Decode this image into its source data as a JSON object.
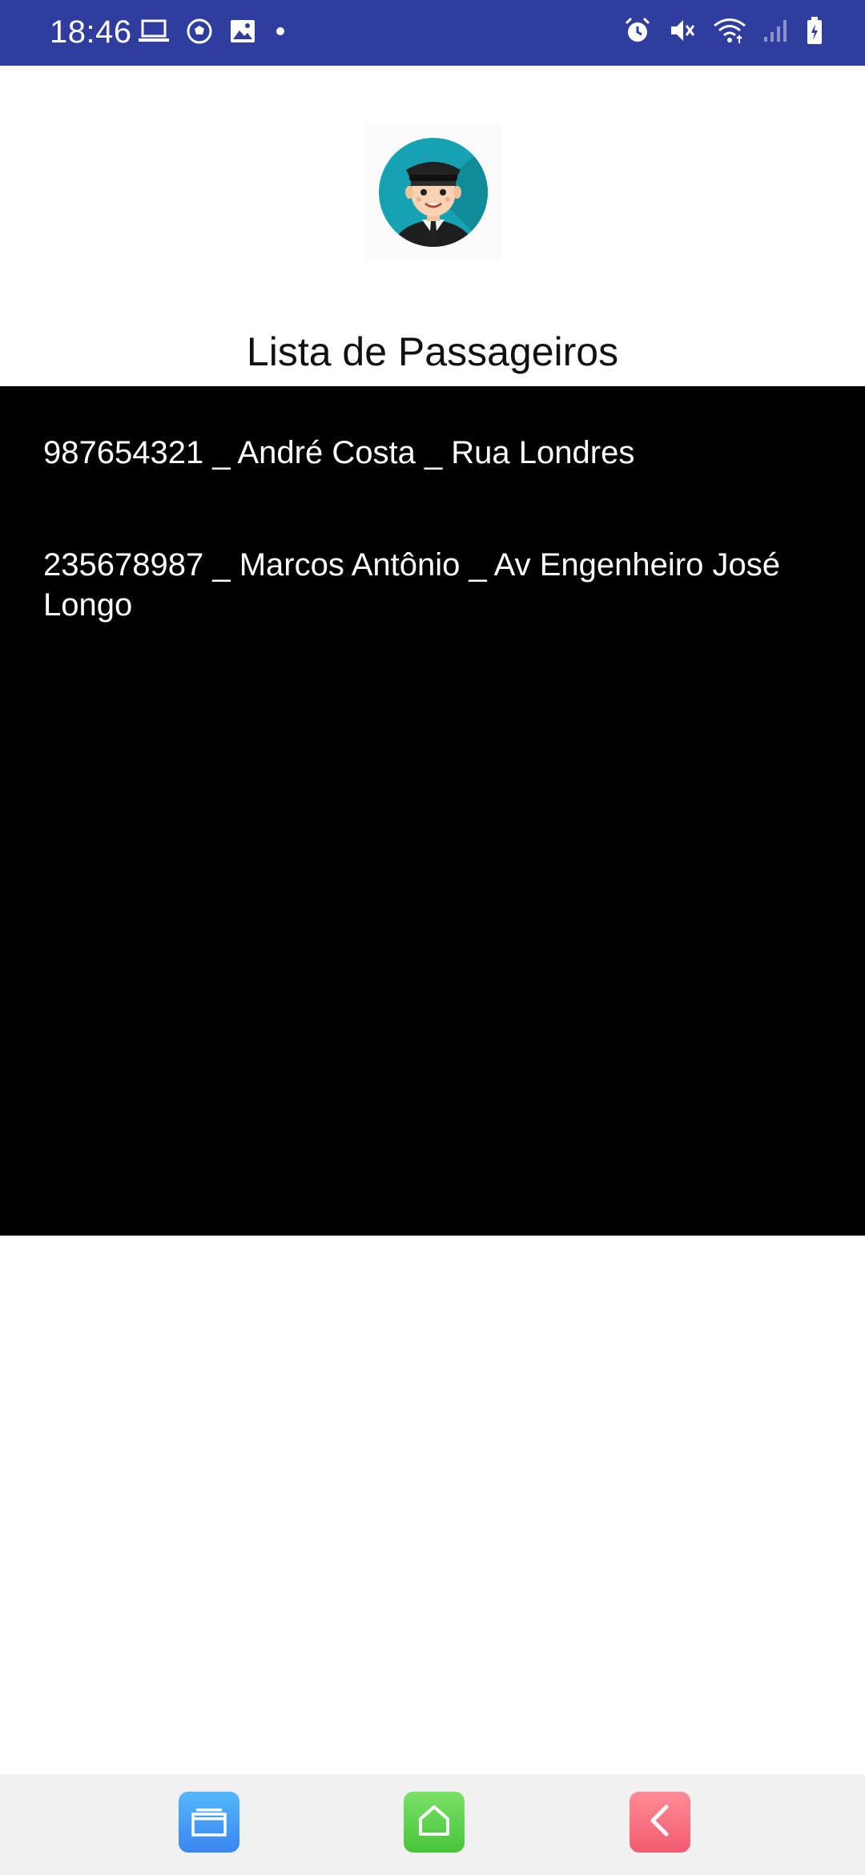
{
  "status_bar": {
    "time": "18:46",
    "left_icons": [
      "laptop-icon",
      "soccer-ball-icon",
      "image-icon",
      "dot-icon"
    ],
    "right_icons": [
      "alarm-icon",
      "mute-icon",
      "wifi-icon",
      "signal-icon",
      "battery-charging-icon"
    ]
  },
  "avatar": {
    "icon": "driver-avatar-icon"
  },
  "page": {
    "title": "Lista de Passageiros"
  },
  "passengers": [
    {
      "text": "987654321 _ André Costa _ Rua Londres"
    },
    {
      "text": "235678987 _ Marcos Antônio  _ Av Engenheiro José Longo"
    }
  ],
  "nav_bar": {
    "recents_icon": "recents-icon",
    "home_icon": "home-icon",
    "back_icon": "back-icon"
  },
  "colors": {
    "status_bar": "#2f3d9e",
    "list_background": "#000000",
    "nav_bar": "#f1f1f1"
  }
}
